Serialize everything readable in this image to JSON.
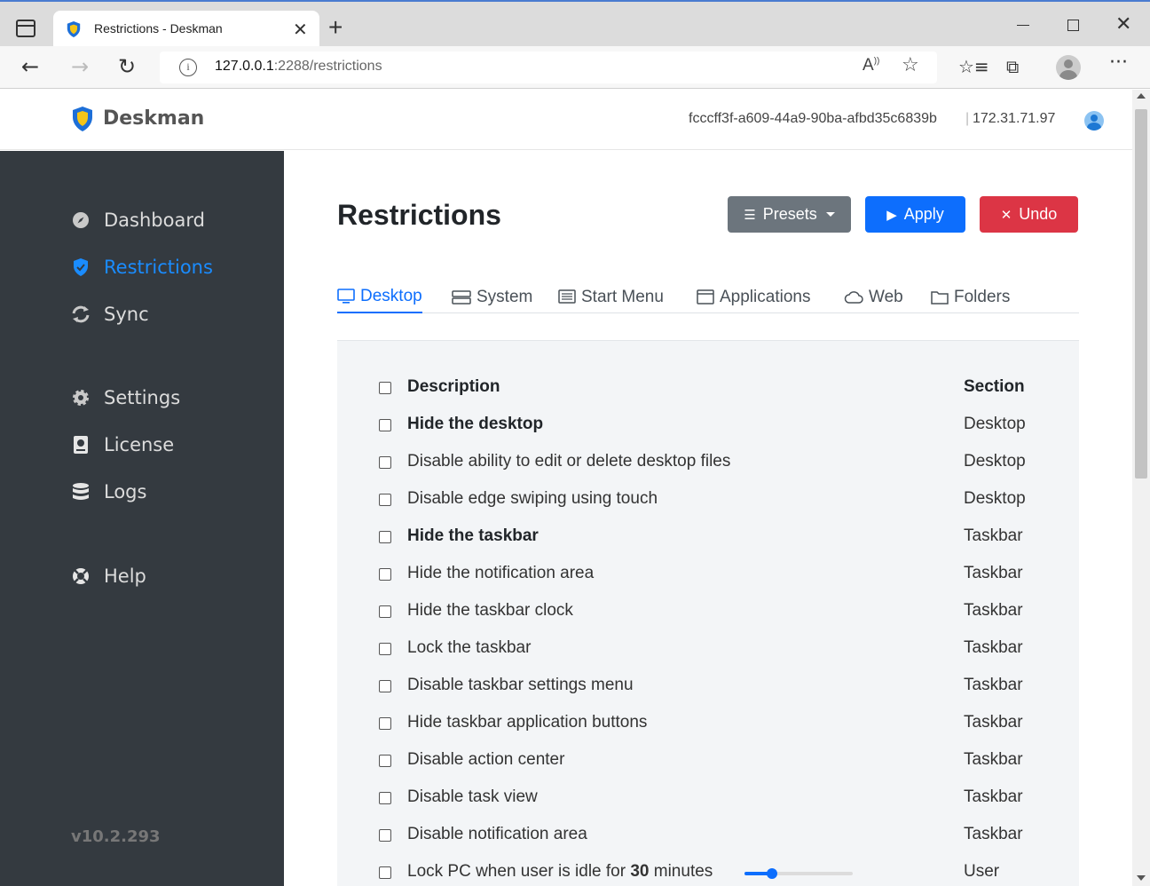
{
  "browser": {
    "tab_title": "Restrictions - Deskman",
    "url_host": "127.0.0.1",
    "url_rest": ":2288/restrictions"
  },
  "header": {
    "brand": "Deskman",
    "machine_id": "fcccff3f-a609-44a9-90ba-afbd35c6839b",
    "separator": "|",
    "ip": "172.31.71.97"
  },
  "sidebar": {
    "items": [
      {
        "label": "Dashboard",
        "icon": "compass-icon"
      },
      {
        "label": "Restrictions",
        "icon": "shield-check-icon",
        "active": true
      },
      {
        "label": "Sync",
        "icon": "sync-icon"
      },
      {
        "label": "Settings",
        "icon": "gear-icon"
      },
      {
        "label": "License",
        "icon": "license-icon"
      },
      {
        "label": "Logs",
        "icon": "database-icon"
      },
      {
        "label": "Help",
        "icon": "life-ring-icon"
      }
    ],
    "version": "v10.2.293"
  },
  "page": {
    "title": "Restrictions",
    "buttons": {
      "presets": "Presets",
      "apply": "Apply",
      "undo": "Undo"
    },
    "tabs": [
      {
        "label": "Desktop",
        "icon": "monitor-icon",
        "active": true
      },
      {
        "label": "System",
        "icon": "hdd-icon"
      },
      {
        "label": "Start Menu",
        "icon": "menu-icon"
      },
      {
        "label": "Applications",
        "icon": "window-icon"
      },
      {
        "label": "Web",
        "icon": "cloud-icon"
      },
      {
        "label": "Folders",
        "icon": "folder-icon"
      }
    ]
  },
  "table": {
    "headers": {
      "description": "Description",
      "section": "Section"
    },
    "rows": [
      {
        "description": "Hide the desktop",
        "section": "Desktop",
        "bold": true
      },
      {
        "description": "Disable ability to edit or delete desktop files",
        "section": "Desktop"
      },
      {
        "description": "Disable edge swiping using touch",
        "section": "Desktop"
      },
      {
        "description": "Hide the taskbar",
        "section": "Taskbar",
        "bold": true
      },
      {
        "description": "Hide the notification area",
        "section": "Taskbar"
      },
      {
        "description": "Hide the taskbar clock",
        "section": "Taskbar"
      },
      {
        "description": "Lock the taskbar",
        "section": "Taskbar"
      },
      {
        "description": "Disable taskbar settings menu",
        "section": "Taskbar"
      },
      {
        "description": "Hide taskbar application buttons",
        "section": "Taskbar"
      },
      {
        "description": "Disable action center",
        "section": "Taskbar"
      },
      {
        "description": "Disable task view",
        "section": "Taskbar"
      },
      {
        "description": "Disable notification area",
        "section": "Taskbar"
      }
    ],
    "idle_row": {
      "prefix": "Lock PC when user is idle for ",
      "minutes": "30",
      "suffix": " minutes",
      "section": "User",
      "slider_fraction": 0.25
    }
  },
  "colors": {
    "sidebar_bg": "#343a40",
    "accent": "#0d6efd",
    "active_nav": "#1a8cff",
    "danger": "#dc3545",
    "secondary": "#6c757d"
  }
}
